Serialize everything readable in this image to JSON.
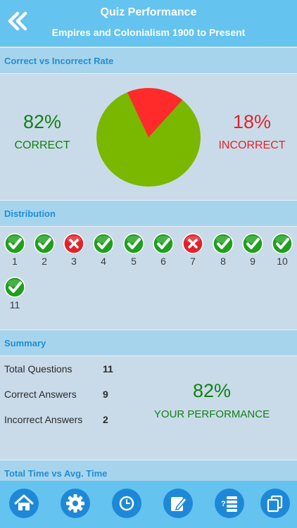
{
  "header": {
    "title": "Quiz Performance",
    "subtitle": "Empires and Colonialism 1900 to Present"
  },
  "sections": {
    "rate": "Correct vs Incorrect Rate",
    "distribution": "Distribution",
    "summary": "Summary",
    "time": "Total Time vs Avg. Time"
  },
  "rate": {
    "correct_pct": "82%",
    "correct_label": "CORRECT",
    "incorrect_pct": "18%",
    "incorrect_label": "INCORRECT",
    "correct_fraction": 0.82,
    "incorrect_fraction": 0.18,
    "correct_color": "#7ab800",
    "incorrect_color": "#ff2b2b"
  },
  "distribution": [
    {
      "n": "1",
      "result": "correct"
    },
    {
      "n": "2",
      "result": "correct"
    },
    {
      "n": "3",
      "result": "incorrect"
    },
    {
      "n": "4",
      "result": "correct"
    },
    {
      "n": "5",
      "result": "correct"
    },
    {
      "n": "6",
      "result": "correct"
    },
    {
      "n": "7",
      "result": "incorrect"
    },
    {
      "n": "8",
      "result": "correct"
    },
    {
      "n": "9",
      "result": "correct"
    },
    {
      "n": "10",
      "result": "correct"
    },
    {
      "n": "11",
      "result": "correct"
    }
  ],
  "summary": {
    "total_label": "Total Questions",
    "total_value": "11",
    "correct_label": "Correct Answers",
    "correct_value": "9",
    "incorrect_label": "Incorrect Answers",
    "incorrect_value": "2",
    "performance_pct": "82%",
    "performance_label": "YOUR PERFORMANCE"
  },
  "tabs": [
    "home-icon",
    "gear-icon",
    "clock-icon",
    "edit-icon",
    "question-list-icon",
    "copy-icon"
  ],
  "colors": {
    "header": "#64c3ef",
    "section_title": "#1f8ed6",
    "correct": "#138013",
    "incorrect": "#e0252d"
  }
}
